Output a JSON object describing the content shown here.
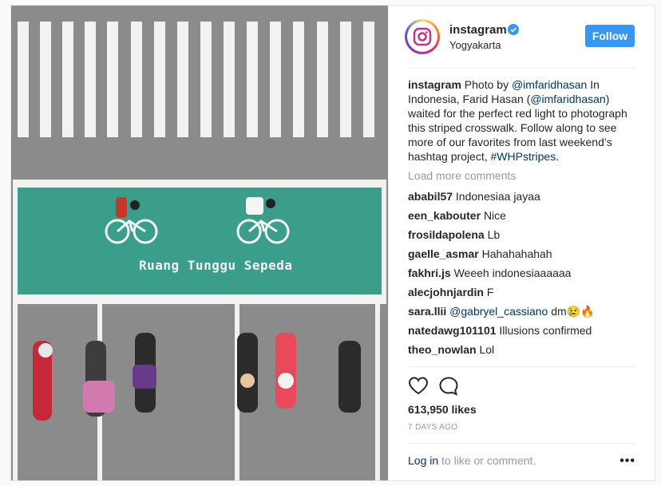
{
  "header": {
    "username": "instagram",
    "location": "Yogyakarta",
    "follow_label": "Follow"
  },
  "caption": {
    "username": "instagram",
    "text_1": " Photo by ",
    "mention_1": "@imfaridhasan",
    "text_2": " In Indonesia, Farid Hasan (",
    "mention_2": "@imfaridhasan",
    "text_3": ") waited for the perfect red light to photograph this striped crosswalk. Follow along to see more of our favorites from last weekend’s hashtag project, ",
    "hashtag": "#WHPstripes",
    "text_4": "."
  },
  "load_more": "Load more comments",
  "comments": [
    {
      "user": "ababil57",
      "text": "Indonesiaa jayaa"
    },
    {
      "user": "een_kabouter",
      "text": "Nice"
    },
    {
      "user": "frosildapolena",
      "text": "Lb"
    },
    {
      "user": "gaelle_asmar",
      "text": "Hahahahahah"
    },
    {
      "user": "fakhri.js",
      "text": "Weeeh indonesiaaaaaa"
    },
    {
      "user": "alecjohnjardin",
      "text": "F"
    },
    {
      "user": "sara.llii",
      "mention": "@gabryel_cassiano",
      "text": "dm😢🔥"
    },
    {
      "user": "natedawg101101",
      "text": "Illusions confirmed"
    },
    {
      "user": "theo_nowlan",
      "text": "Lol"
    }
  ],
  "likes": "613,950 likes",
  "date": "7 DAYS AGO",
  "login": {
    "link": "Log in",
    "rest": " to like or comment."
  },
  "more_options": "•••",
  "photo": {
    "road_text": "Ruang Tunggu Sepeda",
    "colors": {
      "asphalt": "#8b8b8b",
      "bike_box": "#3a9e8a",
      "stripe": "#ffffff"
    }
  },
  "icons": [
    "heart-icon",
    "comment-icon",
    "verified-badge-icon",
    "instagram-logo-icon"
  ],
  "accent_color": "#3897f0"
}
